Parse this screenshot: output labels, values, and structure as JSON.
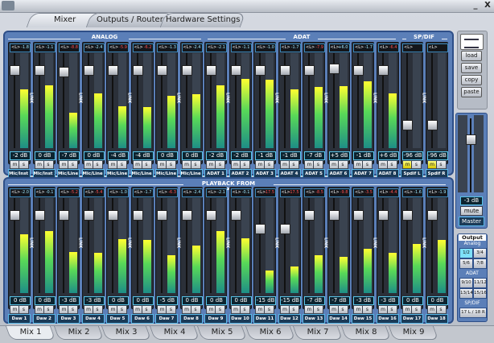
{
  "window": {
    "minimize": "_",
    "close": "X"
  },
  "tabs": [
    "Mixer",
    "Outputs / Router",
    "Hardware Settings"
  ],
  "active_tab": 0,
  "sections": {
    "analog": "ANALOG",
    "adat": "ADAT",
    "spdif": "SP/DIF",
    "playback": "PLAYBACK FROM COMPUTER"
  },
  "link_label": "LINK",
  "input_channels": [
    {
      "name": "Mic/Inst 1",
      "peak": "-1.8",
      "db": "-2 dB",
      "level": 0.62,
      "fader": 0.86,
      "mute": false
    },
    {
      "name": "Mic/Inst 2",
      "peak": "-1.1",
      "db": "0 dB",
      "level": 0.66,
      "fader": 0.86,
      "mute": false
    },
    {
      "name": "Mic/Line 3",
      "peak": "-8.8",
      "db": "-7 dB",
      "level": 0.37,
      "fader": 0.84,
      "mute": false
    },
    {
      "name": "Mic/Line 4",
      "peak": "-2.4",
      "db": "0 dB",
      "level": 0.58,
      "fader": 0.86,
      "mute": false
    },
    {
      "name": "Mic/Line 5",
      "peak": "-5.9",
      "db": "-4 dB",
      "level": 0.44,
      "fader": 0.86,
      "mute": false
    },
    {
      "name": "Mic/Line 6",
      "peak": "-6.2",
      "db": "-4 dB",
      "level": 0.43,
      "fader": 0.86,
      "mute": false
    },
    {
      "name": "Mic/Line 7",
      "peak": "-1.3",
      "db": "0 dB",
      "level": 0.55,
      "fader": 0.86,
      "mute": false
    },
    {
      "name": "Mic/Line 8",
      "peak": "-2.4",
      "db": "0 dB",
      "level": 0.57,
      "fader": 0.86,
      "mute": false
    },
    {
      "name": "ADAT 1",
      "peak": "-2.1",
      "db": "-2 dB",
      "level": 0.66,
      "fader": 0.86,
      "mute": false
    },
    {
      "name": "ADAT 2",
      "peak": "-1.1",
      "db": "-2 dB",
      "level": 0.73,
      "fader": 0.86,
      "mute": false
    },
    {
      "name": "ADAT 3",
      "peak": "-1.0",
      "db": "-1 dB",
      "level": 0.72,
      "fader": 0.86,
      "mute": false
    },
    {
      "name": "ADAT 4",
      "peak": "-1.7",
      "db": "-1 dB",
      "level": 0.62,
      "fader": 0.86,
      "mute": false
    },
    {
      "name": "ADAT 5",
      "peak": "-7.9",
      "db": "-7 dB",
      "level": 0.64,
      "fader": 0.86,
      "mute": false
    },
    {
      "name": "ADAT 6",
      "peak": "+6.0",
      "db": "+5 dB",
      "level": 0.65,
      "fader": 0.88,
      "mute": false
    },
    {
      "name": "ADAT 7",
      "peak": "-1.7",
      "db": "-1 dB",
      "level": 0.7,
      "fader": 0.86,
      "mute": false
    },
    {
      "name": "ADAT 8",
      "peak": "-6.4",
      "db": "+6 dB",
      "level": 0.58,
      "fader": 0.86,
      "mute": false
    },
    {
      "name": "Spdif L",
      "peak": "",
      "db": "-96 dB",
      "level": 0.0,
      "fader": 0.22,
      "mute": true
    },
    {
      "name": "Spdif R",
      "peak": "",
      "db": "-96 dB",
      "level": 0.0,
      "fader": 0.22,
      "mute": true
    }
  ],
  "playback_channels": [
    {
      "name": "Daw 1",
      "peak": "-2.0",
      "db": "0 dB",
      "level": 0.62,
      "fader": 0.86,
      "mute": false
    },
    {
      "name": "Daw 2",
      "peak": "-0.1",
      "db": "0 dB",
      "level": 0.65,
      "fader": 0.86,
      "mute": false
    },
    {
      "name": "Daw 3",
      "peak": "-5.2",
      "db": "-3 dB",
      "level": 0.43,
      "fader": 0.86,
      "mute": false
    },
    {
      "name": "Daw 4",
      "peak": "-5.4",
      "db": "-3 dB",
      "level": 0.42,
      "fader": 0.86,
      "mute": false
    },
    {
      "name": "Daw 5",
      "peak": "-1.0",
      "db": "0 dB",
      "level": 0.57,
      "fader": 0.86,
      "mute": false
    },
    {
      "name": "Daw 6",
      "peak": "-1.7",
      "db": "0 dB",
      "level": 0.56,
      "fader": 0.86,
      "mute": false
    },
    {
      "name": "Daw 7",
      "peak": "-6.3",
      "db": "-5 dB",
      "level": 0.4,
      "fader": 0.86,
      "mute": false
    },
    {
      "name": "Daw 8",
      "peak": "-2.4",
      "db": "0 dB",
      "level": 0.5,
      "fader": 0.86,
      "mute": false
    },
    {
      "name": "Daw 9",
      "peak": "-2.1",
      "db": "0 dB",
      "level": 0.65,
      "fader": 0.86,
      "mute": false
    },
    {
      "name": "Daw 10",
      "peak": "-0.1",
      "db": "0 dB",
      "level": 0.58,
      "fader": 0.86,
      "mute": false
    },
    {
      "name": "Daw 11",
      "peak": "-17.5",
      "db": "-15 dB",
      "level": 0.24,
      "fader": 0.7,
      "mute": false
    },
    {
      "name": "Daw 12",
      "peak": "-17.5",
      "db": "-15 dB",
      "level": 0.28,
      "fader": 0.7,
      "mute": false
    },
    {
      "name": "Daw 13",
      "peak": "-8.5",
      "db": "-7 dB",
      "level": 0.4,
      "fader": 0.86,
      "mute": false
    },
    {
      "name": "Daw 14",
      "peak": "-9.8",
      "db": "-7 dB",
      "level": 0.38,
      "fader": 0.86,
      "mute": false
    },
    {
      "name": "Daw 15",
      "peak": "-3.5",
      "db": "-3 dB",
      "level": 0.47,
      "fader": 0.86,
      "mute": false
    },
    {
      "name": "Daw 16",
      "peak": "-4.4",
      "db": "-3 dB",
      "level": 0.42,
      "fader": 0.86,
      "mute": false
    },
    {
      "name": "Daw 17",
      "peak": "-1.6",
      "db": "0 dB",
      "level": 0.52,
      "fader": 0.86,
      "mute": false
    },
    {
      "name": "Daw 18",
      "peak": "-1.9",
      "db": "0 dB",
      "level": 0.56,
      "fader": 0.86,
      "mute": false
    }
  ],
  "side": {
    "load": "load",
    "save": "save",
    "copy": "copy",
    "paste": "paste"
  },
  "master": {
    "db": "-3 dB",
    "mute": "mute",
    "label": "Master",
    "level": 0.0,
    "fader": 0.74
  },
  "output": {
    "title": "Output",
    "analog": "Analog",
    "adat": "ADAT",
    "spdif": "SP/DIF",
    "buttons": [
      "1/2",
      "3/4",
      "5/6",
      "7/8",
      "9/10",
      "11/12",
      "13/14",
      "15/16",
      "17 L / 18 R"
    ],
    "selected": 0
  },
  "mixes": [
    "Mix 1",
    "Mix 2",
    "Mix 3",
    "Mix 4",
    "Mix 5",
    "Mix 6",
    "Mix 7",
    "Mix 8",
    "Mix 9"
  ],
  "active_mix": 0
}
